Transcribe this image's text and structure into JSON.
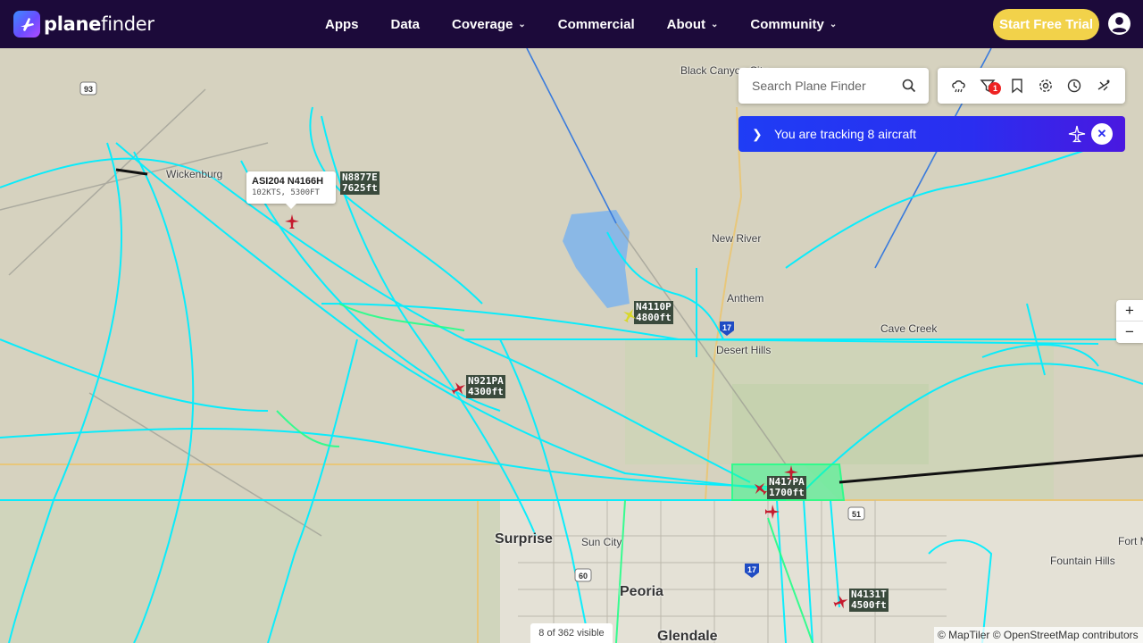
{
  "brand": {
    "name_prefix": "plane",
    "name_suffix": "finder"
  },
  "nav": {
    "links": [
      {
        "label": "Apps",
        "dropdown": false
      },
      {
        "label": "Data",
        "dropdown": false
      },
      {
        "label": "Coverage",
        "dropdown": true
      },
      {
        "label": "Commercial",
        "dropdown": false
      },
      {
        "label": "About",
        "dropdown": true
      },
      {
        "label": "Community",
        "dropdown": true
      }
    ],
    "trial_button": "Start Free Trial",
    "user_icon": "user-icon"
  },
  "search": {
    "placeholder": "Search Plane Finder"
  },
  "toolbar": {
    "icons": [
      "weather-icon",
      "filter-icon",
      "bookmark-icon",
      "settings-icon",
      "history-icon",
      "airport-icon"
    ],
    "filter_badge": "1"
  },
  "tracking": {
    "label": "You are tracking 8 aircraft"
  },
  "zoom": {
    "in": "+",
    "out": "−"
  },
  "places": [
    {
      "name": "Black Canyon City",
      "big": false
    },
    {
      "name": "Wickenburg",
      "big": false
    },
    {
      "name": "New River",
      "big": false
    },
    {
      "name": "Anthem",
      "big": false
    },
    {
      "name": "Cave Creek",
      "big": false
    },
    {
      "name": "Desert Hills",
      "big": false
    },
    {
      "name": "Surprise",
      "big": true
    },
    {
      "name": "Sun City",
      "big": false
    },
    {
      "name": "Peoria",
      "big": true
    },
    {
      "name": "Glendale",
      "big": true
    },
    {
      "name": "Fountain Hills",
      "big": false
    },
    {
      "name": "Fort M",
      "big": false
    }
  ],
  "shields": [
    "93",
    "17",
    "60",
    "51",
    "17"
  ],
  "aircraft": [
    {
      "tag_line1": "N8877E",
      "tag_line2": "7625ft"
    },
    {
      "tag_line1": "N4110P",
      "tag_line2": "4800ft"
    },
    {
      "tag_line1": "N921PA",
      "tag_line2": "4300ft"
    },
    {
      "tag_line1": "N417PA",
      "tag_line2": "1700ft"
    },
    {
      "tag_line1": "N4131T",
      "tag_line2": "4500ft"
    }
  ],
  "callout": {
    "title": "ASI204 N4166H",
    "subtitle": "102KTS, 5300FT"
  },
  "visible_count": "8 of 362 visible",
  "attribution": "© MapTiler © OpenStreetMap contributors",
  "colors": {
    "nav_bg": "#1c0a3a",
    "trial_btn": "#f2d24a",
    "track_cyan": "#00f0ff",
    "track_green": "#22ff88",
    "tracking_bar": "#2a2ef0"
  }
}
